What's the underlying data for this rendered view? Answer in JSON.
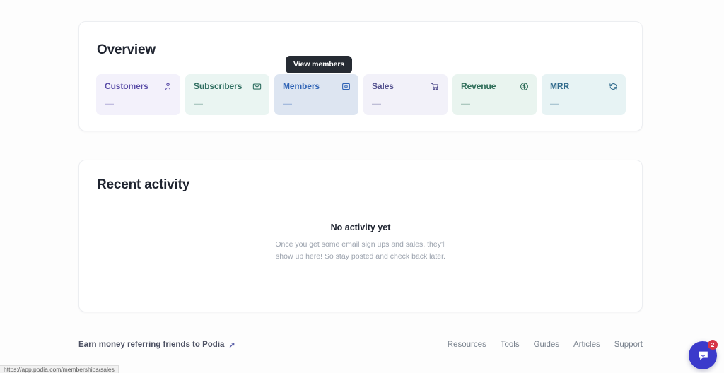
{
  "overview": {
    "title": "Overview",
    "tooltip": "View members",
    "cards": [
      {
        "label": "Customers",
        "value": "—",
        "icon": "person-icon",
        "theme": "card-violet"
      },
      {
        "label": "Subscribers",
        "value": "—",
        "icon": "envelope-icon",
        "theme": "card-mint"
      },
      {
        "label": "Members",
        "value": "—",
        "icon": "id-badge-icon",
        "theme": "card-blue"
      },
      {
        "label": "Sales",
        "value": "—",
        "icon": "cart-icon",
        "theme": "card-lilac"
      },
      {
        "label": "Revenue",
        "value": "—",
        "icon": "dollar-circle-icon",
        "theme": "card-green"
      },
      {
        "label": "MRR",
        "value": "—",
        "icon": "refresh-icon",
        "theme": "card-teal"
      }
    ]
  },
  "activity": {
    "title": "Recent activity",
    "empty_title": "No activity yet",
    "empty_description": "Once you get some email sign ups and sales, they'll show up here! So stay posted and check back later."
  },
  "footer": {
    "referral_label": "Earn money referring friends to Podia",
    "links": [
      "Resources",
      "Tools",
      "Guides",
      "Articles",
      "Support"
    ]
  },
  "chat": {
    "badge_count": "2"
  },
  "status_bar": {
    "url": "https://app.podia.com/memberships/sales"
  },
  "colors": {
    "tooltip_bg": "#262b33",
    "chat_bg": "#3b3acb",
    "badge_bg": "#d63447",
    "page_bg": "#fdfdfd"
  }
}
